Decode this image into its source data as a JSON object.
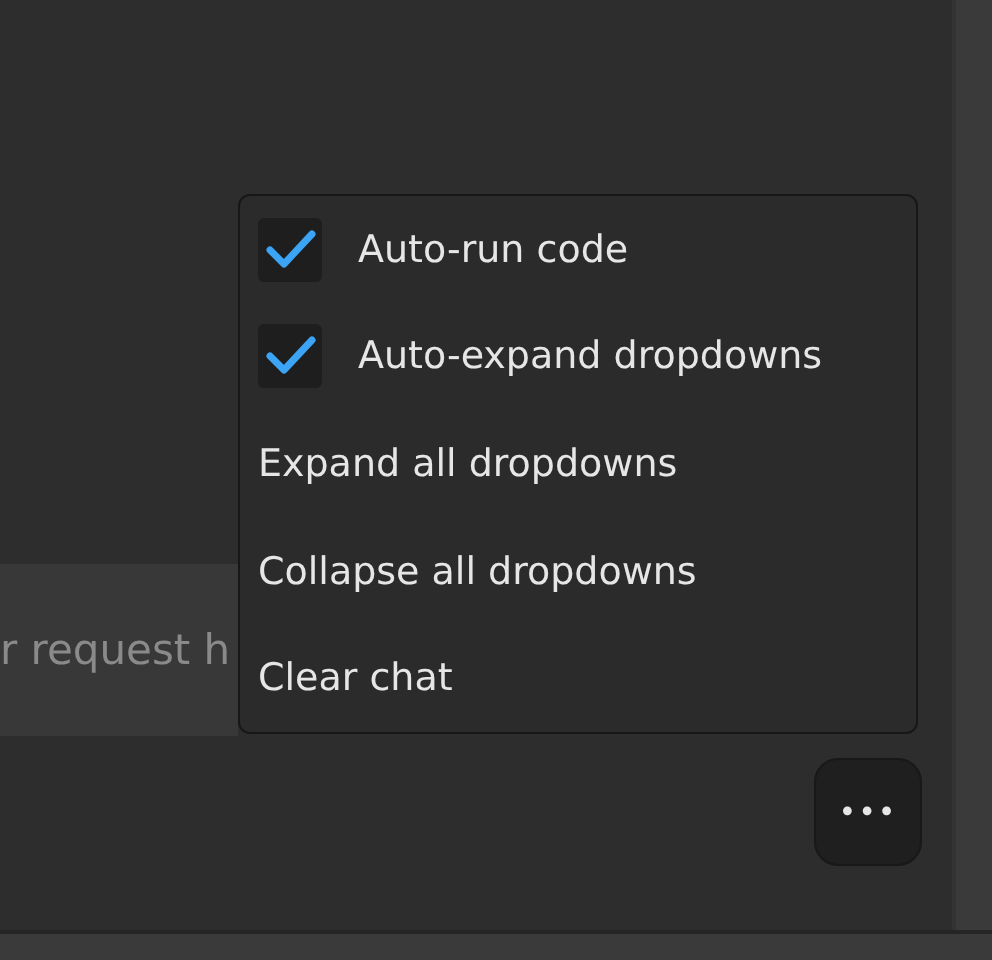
{
  "input": {
    "placeholder": "r request h"
  },
  "menu": {
    "items": [
      {
        "kind": "checkbox",
        "label": "Auto-run code",
        "checked": true
      },
      {
        "kind": "checkbox",
        "label": "Auto-expand dropdowns",
        "checked": true
      },
      {
        "kind": "action",
        "label": "Expand all dropdowns"
      },
      {
        "kind": "action",
        "label": "Collapse all dropdowns"
      },
      {
        "kind": "action",
        "label": "Clear chat"
      }
    ]
  },
  "more_button": {
    "label": "•••"
  }
}
